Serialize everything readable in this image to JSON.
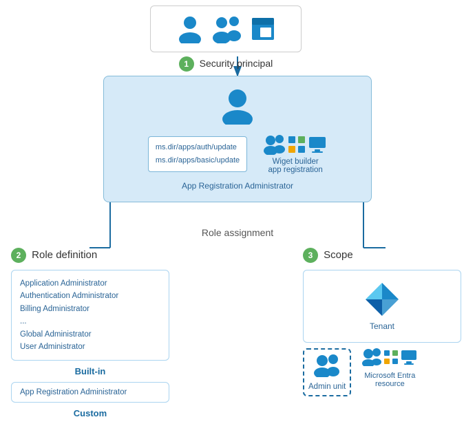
{
  "security_principal": {
    "label": "Security principal",
    "badge": "1"
  },
  "role_assignment": {
    "label": "Role assignment",
    "permissions": [
      "ms.dir/apps/auth/update",
      "ms.dir/apps/basic/update"
    ],
    "admin_label": "App Registration Administrator"
  },
  "role_definition": {
    "badge": "2",
    "label": "Role definition",
    "builtin_roles": [
      "Application Administrator",
      "Authentication Administrator",
      "Billing Administrator",
      "...",
      "Global Administrator",
      "User Administrator"
    ],
    "builtin_label": "Built-in",
    "custom_roles": [
      "App Registration Administrator"
    ],
    "custom_label": "Custom"
  },
  "scope": {
    "badge": "3",
    "label": "Scope",
    "tenant_label": "Tenant",
    "admin_unit_label": "Admin unit",
    "entra_resource_label": "Microsoft Entra\nresource"
  },
  "wiget": {
    "label": "Wiget builder\napp registration"
  }
}
